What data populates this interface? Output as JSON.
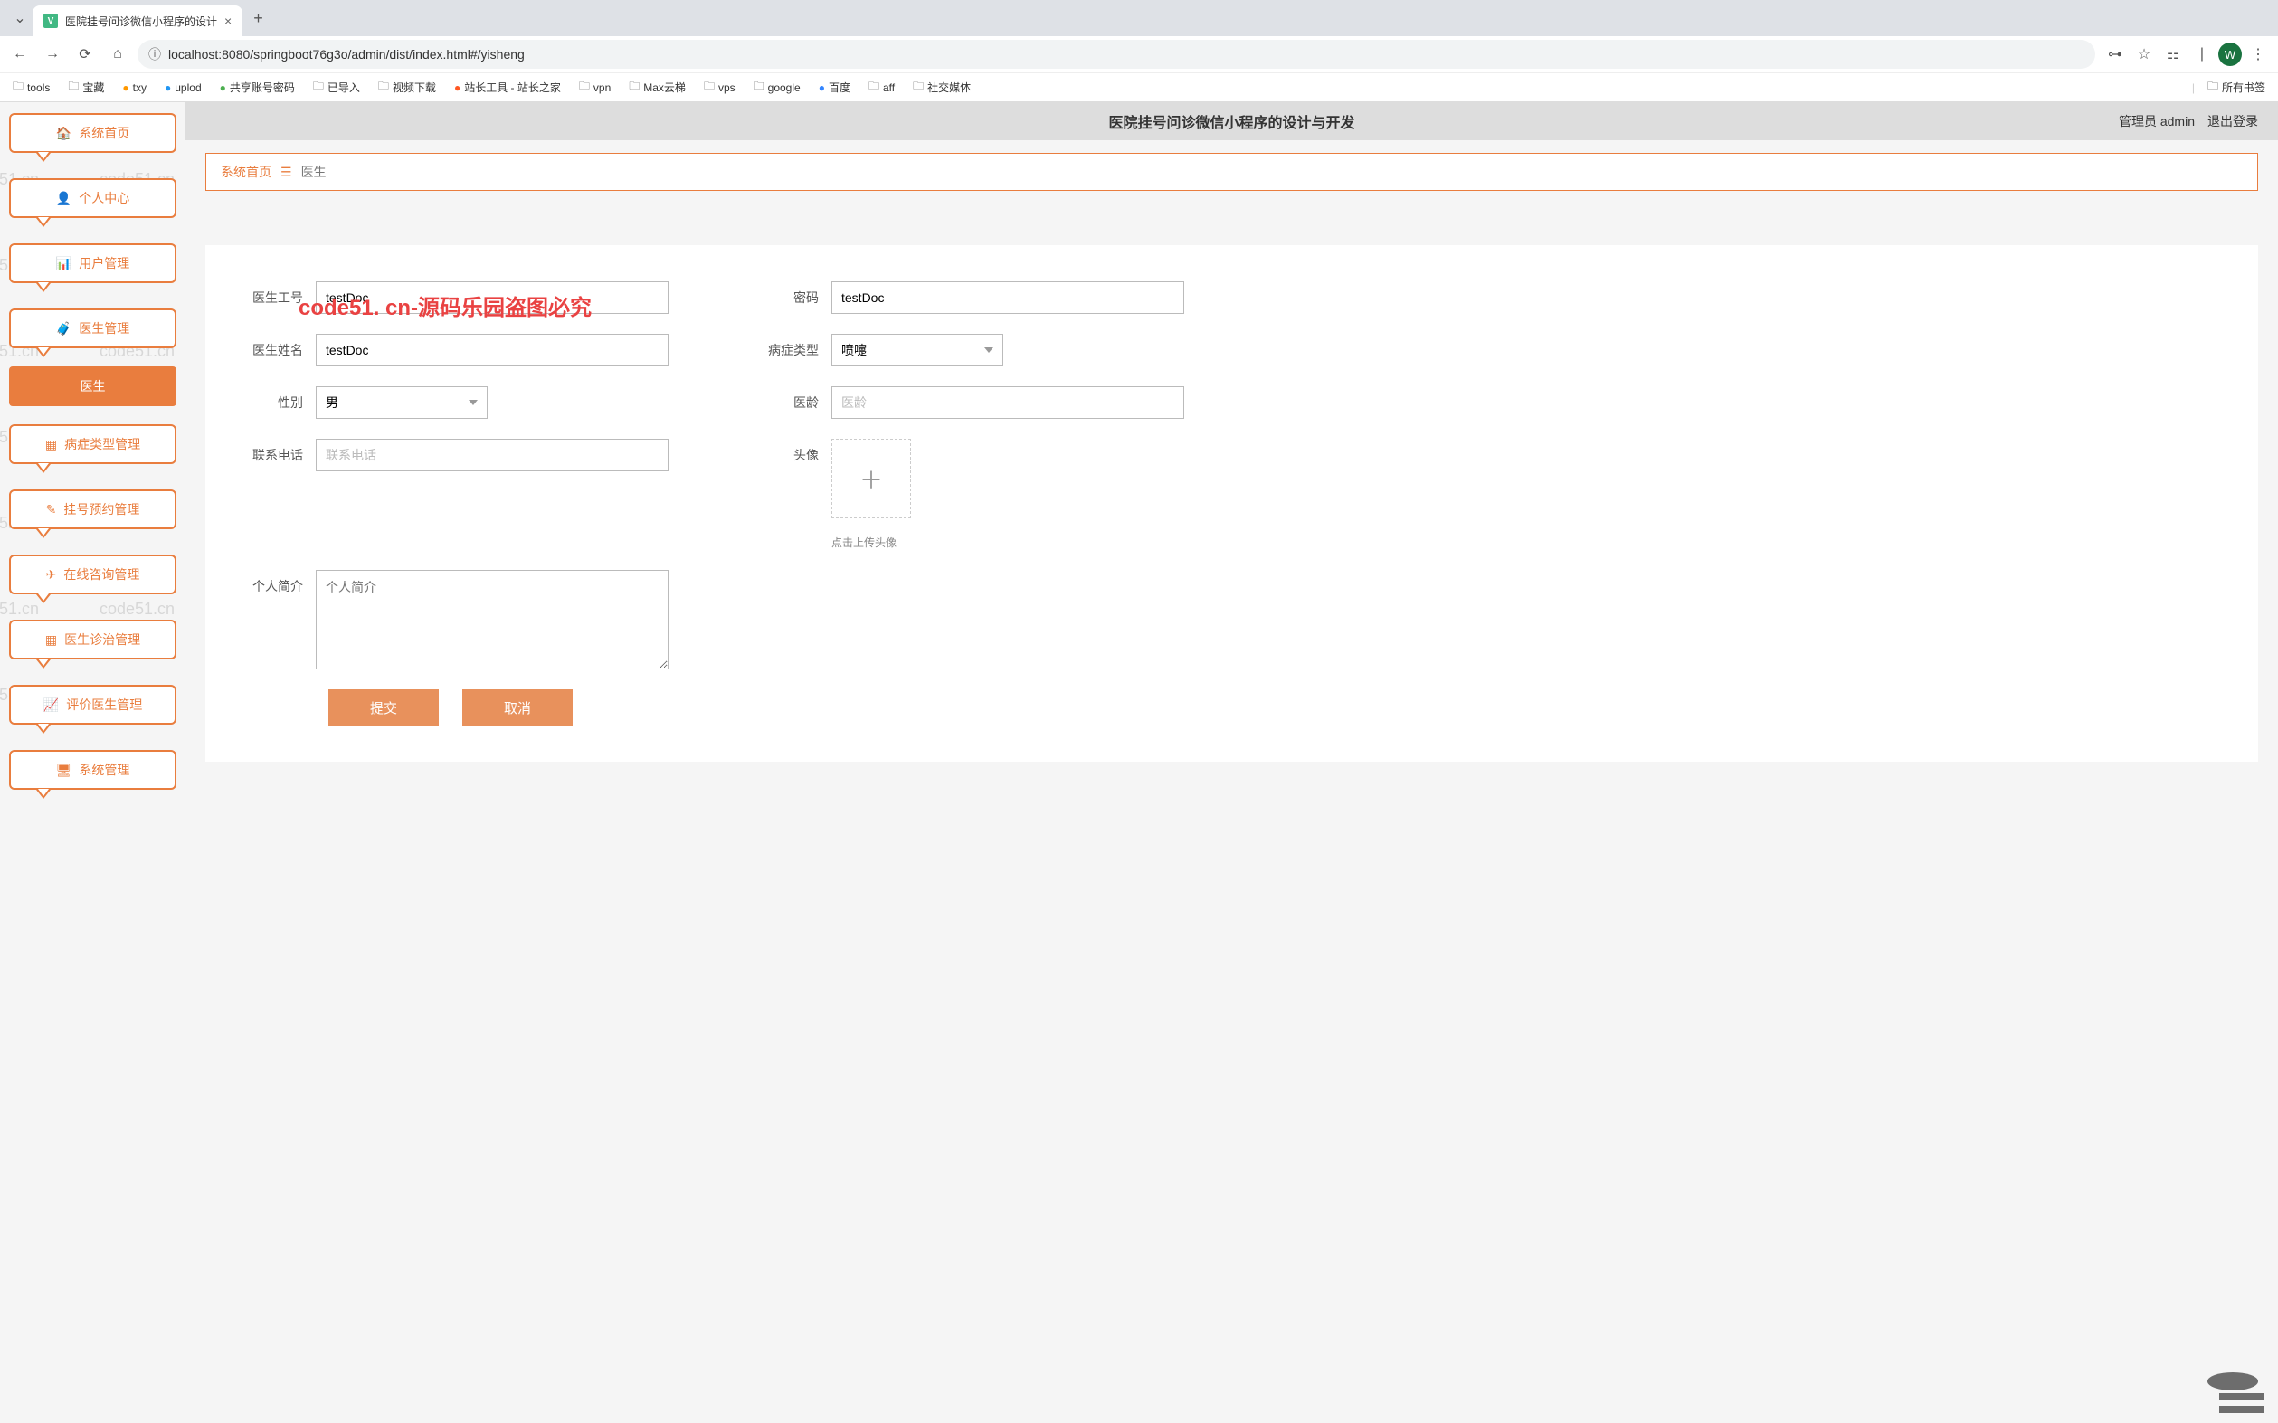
{
  "browser": {
    "tab_title": "医院挂号问诊微信小程序的设计",
    "url": "localhost:8080/springboot76g3o/admin/dist/index.html#/yisheng",
    "avatar_letter": "W",
    "new_tab": "+",
    "close": "×",
    "dropdown": "⌄"
  },
  "bookmarks": [
    {
      "label": "tools",
      "type": "folder"
    },
    {
      "label": "宝藏",
      "type": "folder"
    },
    {
      "label": "txy",
      "type": "link",
      "color": "#ff9800"
    },
    {
      "label": "uplod",
      "type": "link",
      "color": "#2196f3"
    },
    {
      "label": "共享账号密码",
      "type": "link",
      "color": "#4caf50"
    },
    {
      "label": "已导入",
      "type": "folder"
    },
    {
      "label": "视频下载",
      "type": "folder"
    },
    {
      "label": "站长工具 - 站长之家",
      "type": "link",
      "color": "#ff5722"
    },
    {
      "label": "vpn",
      "type": "folder"
    },
    {
      "label": "Max云梯",
      "type": "folder"
    },
    {
      "label": "vps",
      "type": "folder"
    },
    {
      "label": "google",
      "type": "folder"
    },
    {
      "label": "百度",
      "type": "link",
      "color": "#3385ff"
    },
    {
      "label": "aff",
      "type": "folder"
    },
    {
      "label": "社交媒体",
      "type": "folder"
    }
  ],
  "bookmarks_right": {
    "label": "所有书签"
  },
  "sidebar": {
    "items": [
      {
        "icon": "🏠",
        "label": "系统首页"
      },
      {
        "icon": "👤",
        "label": "个人中心"
      },
      {
        "icon": "📊",
        "label": "用户管理"
      },
      {
        "icon": "🧳",
        "label": "医生管理"
      }
    ],
    "active": "医生",
    "items2": [
      {
        "icon": "▦",
        "label": "病症类型管理"
      },
      {
        "icon": "✎",
        "label": "挂号预约管理"
      },
      {
        "icon": "✈",
        "label": "在线咨询管理"
      },
      {
        "icon": "▦",
        "label": "医生诊治管理"
      },
      {
        "icon": "📈",
        "label": "评价医生管理"
      },
      {
        "icon": "🖥",
        "label": "系统管理"
      }
    ]
  },
  "header": {
    "title": "医院挂号问诊微信小程序的设计与开发",
    "role": "管理员",
    "user": "admin",
    "logout": "退出登录"
  },
  "breadcrumb": {
    "home": "系统首页",
    "sep": "☰",
    "current": "医生"
  },
  "form": {
    "doctor_id_label": "医生工号",
    "doctor_id_value": "testDoc",
    "password_label": "密码",
    "password_value": "testDoc",
    "doctor_name_label": "医生姓名",
    "doctor_name_value": "testDoc",
    "disease_type_label": "病症类型",
    "disease_type_value": "喷嚏",
    "gender_label": "性别",
    "gender_value": "男",
    "med_age_label": "医龄",
    "med_age_placeholder": "医龄",
    "phone_label": "联系电话",
    "phone_placeholder": "联系电话",
    "avatar_label": "头像",
    "avatar_hint": "点击上传头像",
    "profile_label": "个人简介",
    "profile_placeholder": "个人简介",
    "submit": "提交",
    "cancel": "取消"
  },
  "watermark": "code51.cn",
  "red_watermark": "code51. cn-源码乐园盗图必究"
}
